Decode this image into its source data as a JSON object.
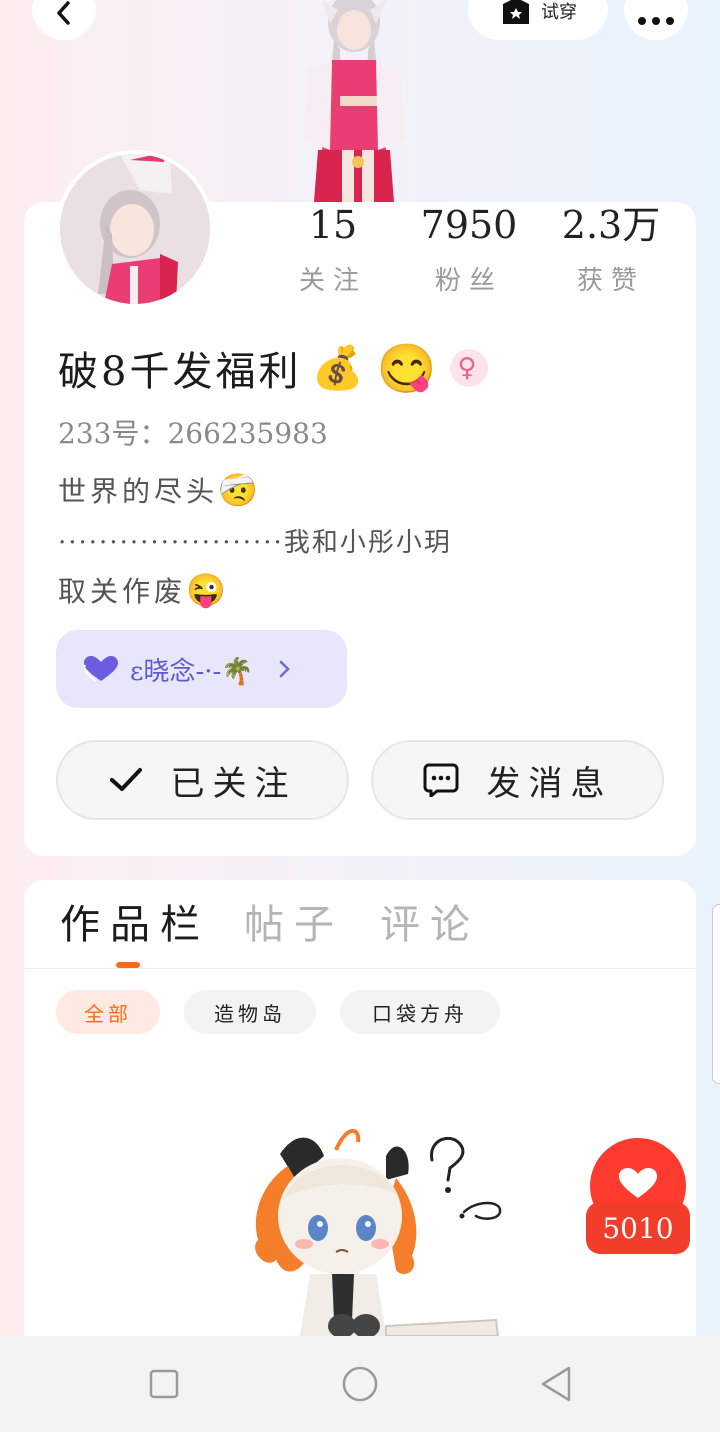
{
  "topbar": {
    "try_on_label": "试穿",
    "icons": [
      "back-icon",
      "wardrobe-icon",
      "more-icon"
    ]
  },
  "profile": {
    "stats": [
      {
        "value": "15",
        "label": "关注"
      },
      {
        "value": "7950",
        "label": "粉丝"
      },
      {
        "value": "2.3万",
        "label": "获赞"
      }
    ],
    "nickname": "破8千发福利",
    "nickname_emojis": [
      "💰",
      "😋"
    ],
    "gender_icon": "♀",
    "uid": "233号：266235983",
    "bio_lines": [
      {
        "text": "世界的尽头",
        "emoji": "🤕"
      },
      {
        "text": "······················我和小彤小玥",
        "emoji": ""
      },
      {
        "text": "取关作废",
        "emoji": "😜"
      }
    ],
    "tag": {
      "text": "ε晓念-·-🌴",
      "icon": "heart-icon"
    },
    "follow_button": "已关注",
    "message_button": "发消息"
  },
  "content": {
    "tabs": [
      "作品栏",
      "帖子",
      "评论"
    ],
    "active_tab": 0,
    "filters": [
      "全部",
      "造物岛",
      "口袋方舟"
    ],
    "active_filter": 0,
    "like_count": "5010"
  },
  "colors": {
    "accent_orange": "#ff6a1a",
    "like_red": "#f23d2b",
    "tag_bg": "#e7e6fb",
    "tag_text": "#5d5ad6"
  }
}
